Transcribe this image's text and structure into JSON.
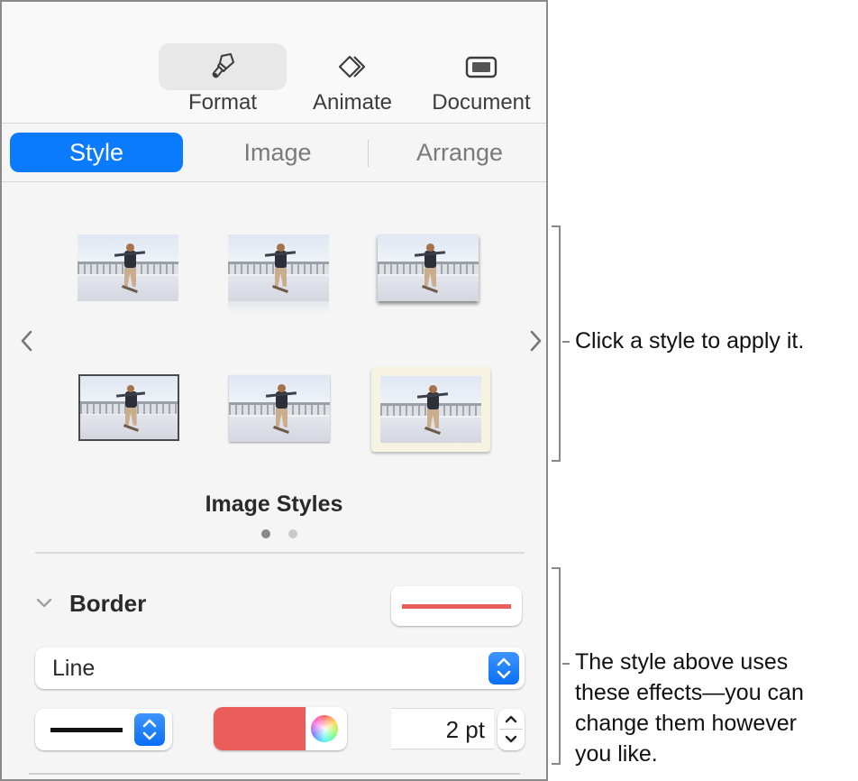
{
  "toolbar": {
    "buttons": [
      {
        "label": "Format",
        "icon": "paintbrush-icon",
        "active": true
      },
      {
        "label": "Animate",
        "icon": "animate-diamonds-icon",
        "active": false
      },
      {
        "label": "Document",
        "icon": "document-icon",
        "active": false
      }
    ]
  },
  "tabs": [
    {
      "label": "Style",
      "selected": true
    },
    {
      "label": "Image",
      "selected": false
    },
    {
      "label": "Arrange",
      "selected": false
    }
  ],
  "image_styles": {
    "title": "Image Styles",
    "styles": [
      {
        "name": "plain"
      },
      {
        "name": "reflection"
      },
      {
        "name": "drop-shadow"
      },
      {
        "name": "dark-border"
      },
      {
        "name": "thin-shadow"
      },
      {
        "name": "cream-frame"
      }
    ],
    "page_count": 2,
    "current_page": 1,
    "prev_icon": "chevron-left-icon",
    "next_icon": "chevron-right-icon"
  },
  "border": {
    "label": "Border",
    "expanded": true,
    "type_value": "Line",
    "line_style": "solid",
    "color": "#ea5d5a",
    "width_value": "2 pt"
  },
  "callouts": {
    "styles": "Click a style to apply it.",
    "effects_lines": [
      "The style above uses",
      "these effects—you can",
      "change them however",
      "you like."
    ]
  },
  "colors": {
    "accent": "#0a7aff",
    "border_color": "#ea5d5a",
    "dot_active": "#8a8a8a",
    "dot_inactive": "#c8c8c8"
  }
}
